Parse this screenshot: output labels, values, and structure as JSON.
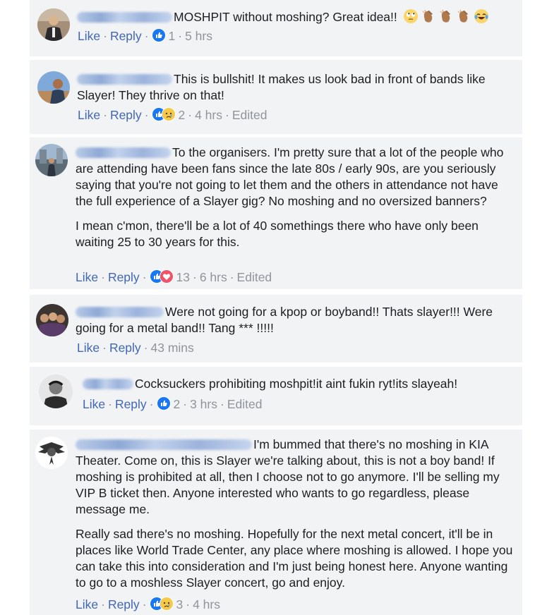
{
  "colors": {
    "link": "#4267b2",
    "meta": "#90949c",
    "bubble": "#f2f3f5",
    "like_blue": "#1877f2",
    "love_red": "#f25268",
    "sad_yellow": "#f7c948"
  },
  "actions": {
    "like": "Like",
    "reply": "Reply"
  },
  "comments": [
    {
      "paragraphs": [
        "MOSHPIT without moshing? Great idea!!"
      ],
      "emojis": [
        "eye-roll-emoji",
        "clapping-hands-emoji",
        "clapping-hands-emoji",
        "clapping-hands-emoji",
        "tears-of-joy-emoji"
      ],
      "reactions": [
        "like"
      ],
      "reaction_count": "1",
      "time": "5 hrs",
      "edited": ""
    },
    {
      "paragraphs": [
        "This is bullshit! It makes us look bad in front of bands like Slayer! They thrive on that!"
      ],
      "reactions": [
        "like",
        "sad"
      ],
      "reaction_count": "2",
      "time": "4 hrs",
      "edited": "Edited"
    },
    {
      "paragraphs": [
        "To the organisers. I'm pretty sure that a lot of the people who are attending have been fans since the late 80s / early 90s, are you seriously saying that you're not going to let them and the others in attendance not have the full experience of a Slayer gig? No moshing and no oversized banners?",
        "I mean c'mon, there'll be a lot of 40 somethings there who have only been waiting 25 to 30 years for this."
      ],
      "reactions": [
        "like",
        "love"
      ],
      "reaction_count": "13",
      "time": "6 hrs",
      "edited": "Edited"
    },
    {
      "paragraphs": [
        "Were not going for a kpop or boyband!! Thats slayer!!! Were going for a metal band!! Tang *** !!!!!"
      ],
      "reactions": [],
      "reaction_count": "",
      "time": "43 mins",
      "edited": ""
    },
    {
      "paragraphs": [
        "Cocksuckers prohibiting moshpit!it aint fukin ryt!its slayeah!"
      ],
      "reactions": [
        "like"
      ],
      "reaction_count": "2",
      "time": "3 hrs",
      "edited": "Edited"
    },
    {
      "paragraphs": [
        "I'm bummed that there's no moshing in KIA Theater. Come on, this is Slayer we're talking about, this is not a boy band! If moshing is prohibited at all, then I choose not to go anymore. I'll be selling my VIP B ticket then. Anyone interested who wants to go regardless, please message me.",
        "Really sad there's no moshing. Hopefully for the next metal concert, it'll be in places like World Trade Center, any place where moshing is allowed. I hope you can take this into consideration and I'm just being honest here. Anyone wanting to go to a moshless Slayer concert, go and enjoy."
      ],
      "reactions": [
        "like",
        "sad"
      ],
      "reaction_count": "3",
      "time": "4 hrs",
      "edited": ""
    }
  ]
}
